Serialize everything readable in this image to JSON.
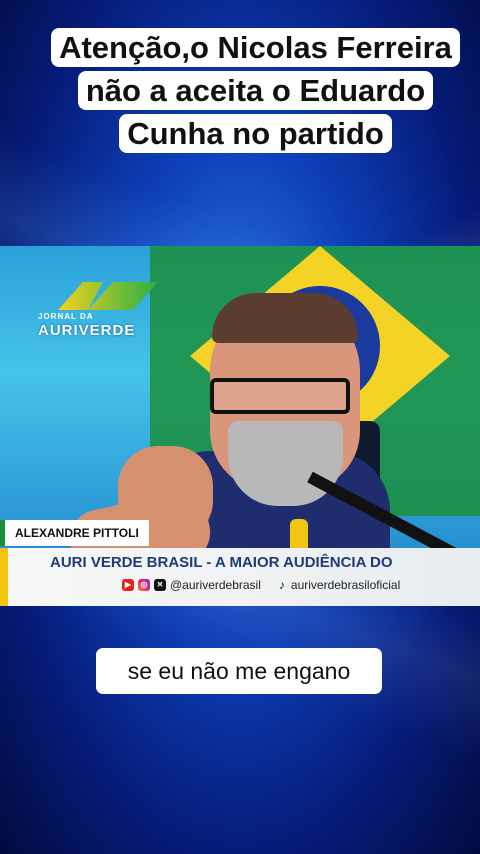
{
  "headline": "Atenção,o Nicolas Ferreira não a aceita o Eduardo Cunha no partido",
  "video": {
    "logo_small": "JORNAL DA",
    "logo_big": "AURIVERDE",
    "name_tag": "ALEXANDRE PITTOLI",
    "banner_title": "AURI VERDE BRASIL - A MAIOR AUDIÊNCIA DO",
    "social_handle": "@auriverdebrasil",
    "tiktok_handle": "auriverdebrasiloficial",
    "icons": [
      "youtube-icon",
      "instagram-icon",
      "x-icon",
      "tiktok-icon"
    ]
  },
  "caption": "se eu não me engano",
  "colors": {
    "background": "#0d3fb8",
    "banner_text": "#1e3b7a",
    "flag_green": "#1b8f3c",
    "flag_yellow": "#f2d326"
  }
}
